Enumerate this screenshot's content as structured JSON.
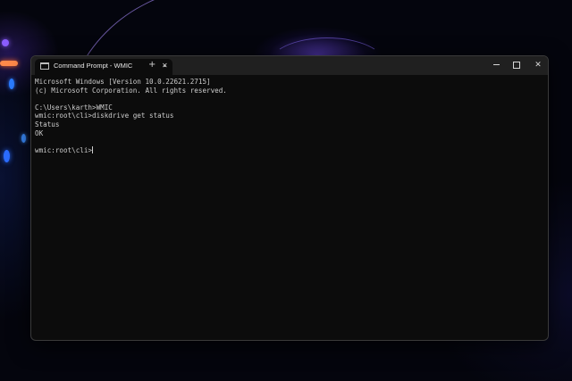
{
  "window": {
    "tab_title": "Command Prompt - WMIC",
    "tab_close_icon": "✕",
    "new_tab_icon": "+",
    "dropdown_icon": "⌄",
    "close_icon": "✕"
  },
  "console": {
    "lines": [
      "Microsoft Windows [Version 10.0.22621.2715]",
      "(c) Microsoft Corporation. All rights reserved.",
      "",
      "C:\\Users\\karth>WMIC",
      "wmic:root\\cli>diskdrive get status",
      "Status",
      "OK",
      "",
      "wmic:root\\cli>"
    ]
  },
  "colors": {
    "terminal_bg": "#0c0c0c",
    "titlebar_bg": "#202020",
    "text": "#cccccc"
  }
}
